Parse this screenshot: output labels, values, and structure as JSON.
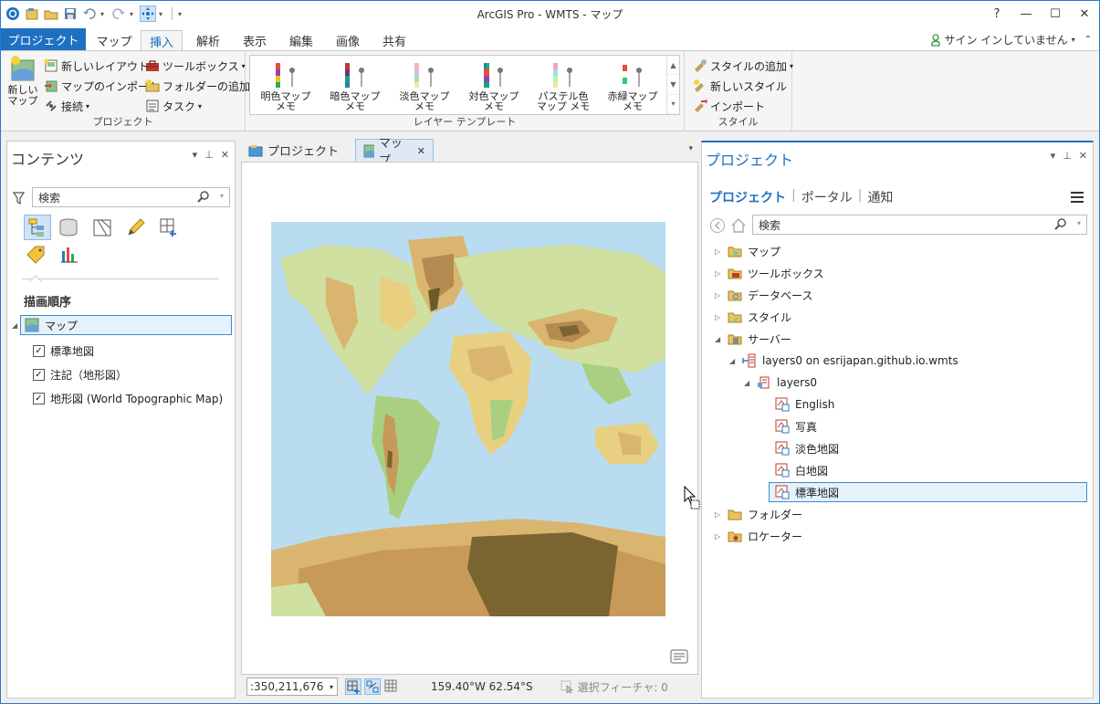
{
  "window": {
    "title": "ArcGIS Pro - WMTS - マップ",
    "help": "?"
  },
  "tabs": [
    "マップ",
    "挿入",
    "解析",
    "表示",
    "編集",
    "画像",
    "共有"
  ],
  "project_tab": "プロジェクト",
  "signin": "サイン インしていません",
  "ribbon": {
    "project_group": {
      "label": "プロジェクト",
      "new_map": "新しい\nマップ",
      "new_layout": "新しいレイアウト",
      "import_map": "マップのインポート",
      "connect": "接続",
      "toolbox": "ツールボックス",
      "add_folder": "フォルダーの追加",
      "task": "タスク"
    },
    "layer_template_group": {
      "label": "レイヤー テンプレート",
      "items": [
        "明色マップ\nメモ",
        "暗色マップ\nメモ",
        "淡色マップ\nメモ",
        "対色マップ\nメモ",
        "パステル色\nマップ メモ",
        "赤緑マップ\nメモ"
      ]
    },
    "style_group": {
      "label": "スタイル",
      "add_style": "スタイルの追加",
      "new_style": "新しいスタイル",
      "import": "インポート"
    }
  },
  "contents": {
    "title": "コンテンツ",
    "search_placeholder": "検索",
    "drawing_order": "描画順序",
    "map_name": "マップ",
    "layers": [
      "標準地図",
      "注記（地形図）",
      "地形図 (World Topographic Map)"
    ]
  },
  "map_tabs": [
    "プロジェクト",
    "マップ"
  ],
  "status": {
    "scale": ":350,211,676",
    "coords": "159.40°W 62.54°S",
    "selected": "選択フィーチャ: 0"
  },
  "project_pane": {
    "title": "プロジェクト",
    "nav": [
      "プロジェクト",
      "ポータル",
      "通知"
    ],
    "search_placeholder": "検索",
    "tree": {
      "map": "マップ",
      "toolbox": "ツールボックス",
      "database": "データベース",
      "style": "スタイル",
      "server": "サーバー",
      "wmts": "layers0 on esrijapan.github.io.wmts",
      "layers0": "layers0",
      "children": [
        "English",
        "写真",
        "淡色地図",
        "白地図",
        "標準地図"
      ],
      "folder": "フォルダー",
      "locator": "ロケーター"
    }
  },
  "colors": {
    "accent": "#1e70c1",
    "ocean": "#b9dcf0",
    "land_low": "#cfe0a0",
    "land_high": "#c79a5a",
    "land_peak": "#7a6430"
  }
}
